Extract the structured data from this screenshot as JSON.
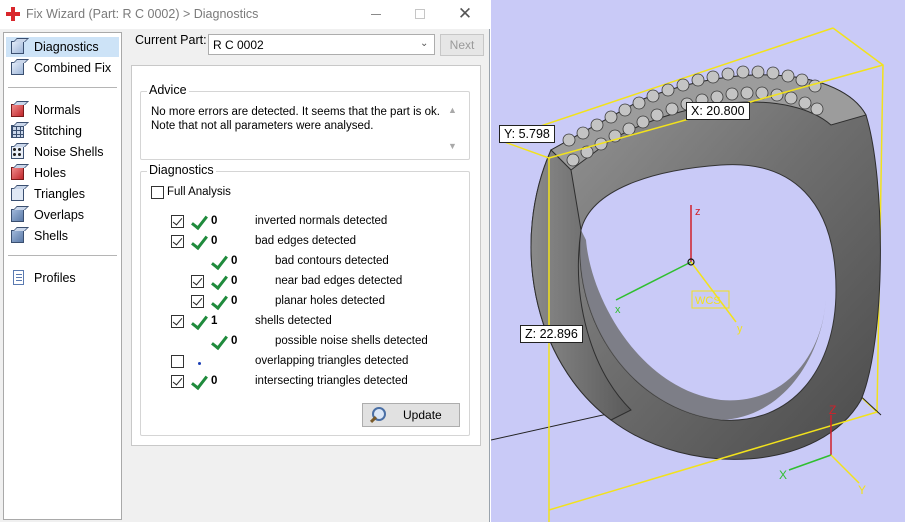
{
  "window": {
    "title": "Fix Wizard (Part: R C 0002) > Diagnostics",
    "close_glyph": "✕"
  },
  "sidebar": {
    "items": [
      {
        "label": "Diagnostics",
        "icon": "diagnostics-icon",
        "selected": true
      },
      {
        "label": "Combined Fix",
        "icon": "combined-fix-icon"
      },
      {
        "label": "Normals",
        "icon": "normals-icon"
      },
      {
        "label": "Stitching",
        "icon": "stitching-icon"
      },
      {
        "label": "Noise Shells",
        "icon": "noise-shells-icon"
      },
      {
        "label": "Holes",
        "icon": "holes-icon"
      },
      {
        "label": "Triangles",
        "icon": "triangles-icon"
      },
      {
        "label": "Overlaps",
        "icon": "overlaps-icon"
      },
      {
        "label": "Shells",
        "icon": "shells-icon"
      },
      {
        "label": "Profiles",
        "icon": "profiles-icon"
      }
    ]
  },
  "header": {
    "current_part_label": "Current Part:",
    "current_part_value": "R C 0002",
    "next_label": "Next"
  },
  "advice": {
    "title": "Advice",
    "text": "No more errors are detected. It seems that the part is ok.\nNote that not all parameters were analysed."
  },
  "diagnostics": {
    "title": "Diagnostics",
    "full_analysis_label": "Full Analysis",
    "full_analysis_checked": false,
    "rows": [
      {
        "checked": true,
        "ok": true,
        "count": "0",
        "label": "inverted normals detected"
      },
      {
        "checked": true,
        "ok": true,
        "count": "0",
        "label": "bad edges detected"
      },
      {
        "checked": null,
        "ok": true,
        "count": "0",
        "label": "bad contours detected"
      },
      {
        "checked": true,
        "ok": true,
        "count": "0",
        "label": "near bad edges detected"
      },
      {
        "checked": true,
        "ok": true,
        "count": "0",
        "label": "planar holes detected"
      },
      {
        "checked": true,
        "ok": true,
        "count": "1",
        "label": "shells detected"
      },
      {
        "checked": null,
        "ok": true,
        "count": "0",
        "label": "possible noise shells detected"
      },
      {
        "checked": false,
        "ok": false,
        "count": "",
        "label": "overlapping triangles detected"
      },
      {
        "checked": true,
        "ok": true,
        "count": "0",
        "label": "intersecting triangles detected"
      }
    ],
    "update_label": "Update"
  },
  "viewport": {
    "background": "#c9caf7",
    "bbox_color": "#f2e21c",
    "x_label": "X: 20.800",
    "y_label": "Y: 5.798",
    "z_label": "Z: 22.896",
    "wcs_label": "WCS",
    "axis_z": "z",
    "axis_x": "x",
    "axis_y": "y",
    "corner_axis_z": "Z",
    "corner_axis_x": "X",
    "corner_axis_y": "Y"
  }
}
